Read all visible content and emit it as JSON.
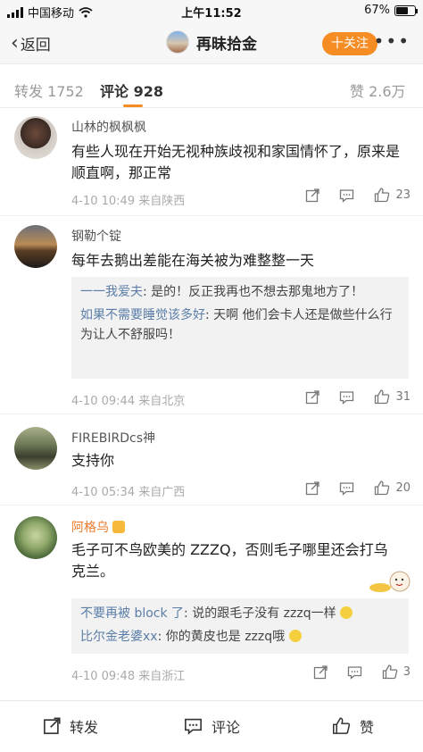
{
  "status": {
    "carrier": "中国移动",
    "time": "上午11:52",
    "battery": "67%",
    "battery_level": 0.67
  },
  "nav": {
    "back": "返回",
    "title": "再昧拾金",
    "follow": "十关注"
  },
  "tabs": {
    "repost": "转发 1752",
    "comments": "评论 928",
    "likes": "赞 2.6万"
  },
  "comments": [
    {
      "user": "山林的枫枫枫",
      "text": "有些人现在开始无视种族歧视和家国情怀了，原来是顺直啊，那正常",
      "meta": "4-10 10:49  来自陕西",
      "likes": "23"
    },
    {
      "user": "钢勒个锭",
      "text": "每年去鹅出差能在海关被为难整整一天",
      "replies": [
        {
          "name": "一一我爱夫",
          "text": ": 是的！反正我再也不想去那鬼地方了！"
        },
        {
          "name": "如果不需要睡觉该多好",
          "text": ": 天啊  他们会卡人还是做些什么行为让人不舒服吗！"
        }
      ],
      "meta": "4-10 09:44  来自北京",
      "likes": "31"
    },
    {
      "user": "FIREBIRDcs神",
      "text": "支持你",
      "meta": "4-10 05:34  来自广西",
      "likes": "20"
    },
    {
      "user": "阿格乌",
      "text": "毛子可不鸟欧美的 ZZZQ，否则毛子哪里还会打乌克兰。",
      "replies": [
        {
          "name": "不要再被 block 了",
          "text": ": 说的跟毛子没有 zzzq一样"
        },
        {
          "name": "比尔金老婆xx",
          "text": ": 你的黄皮也是 zzzq哦"
        }
      ],
      "meta": "4-10 09:48  来自浙江",
      "likes": "3"
    }
  ],
  "toolbar": {
    "repost": "转发",
    "comment": "评论",
    "like": "赞"
  }
}
